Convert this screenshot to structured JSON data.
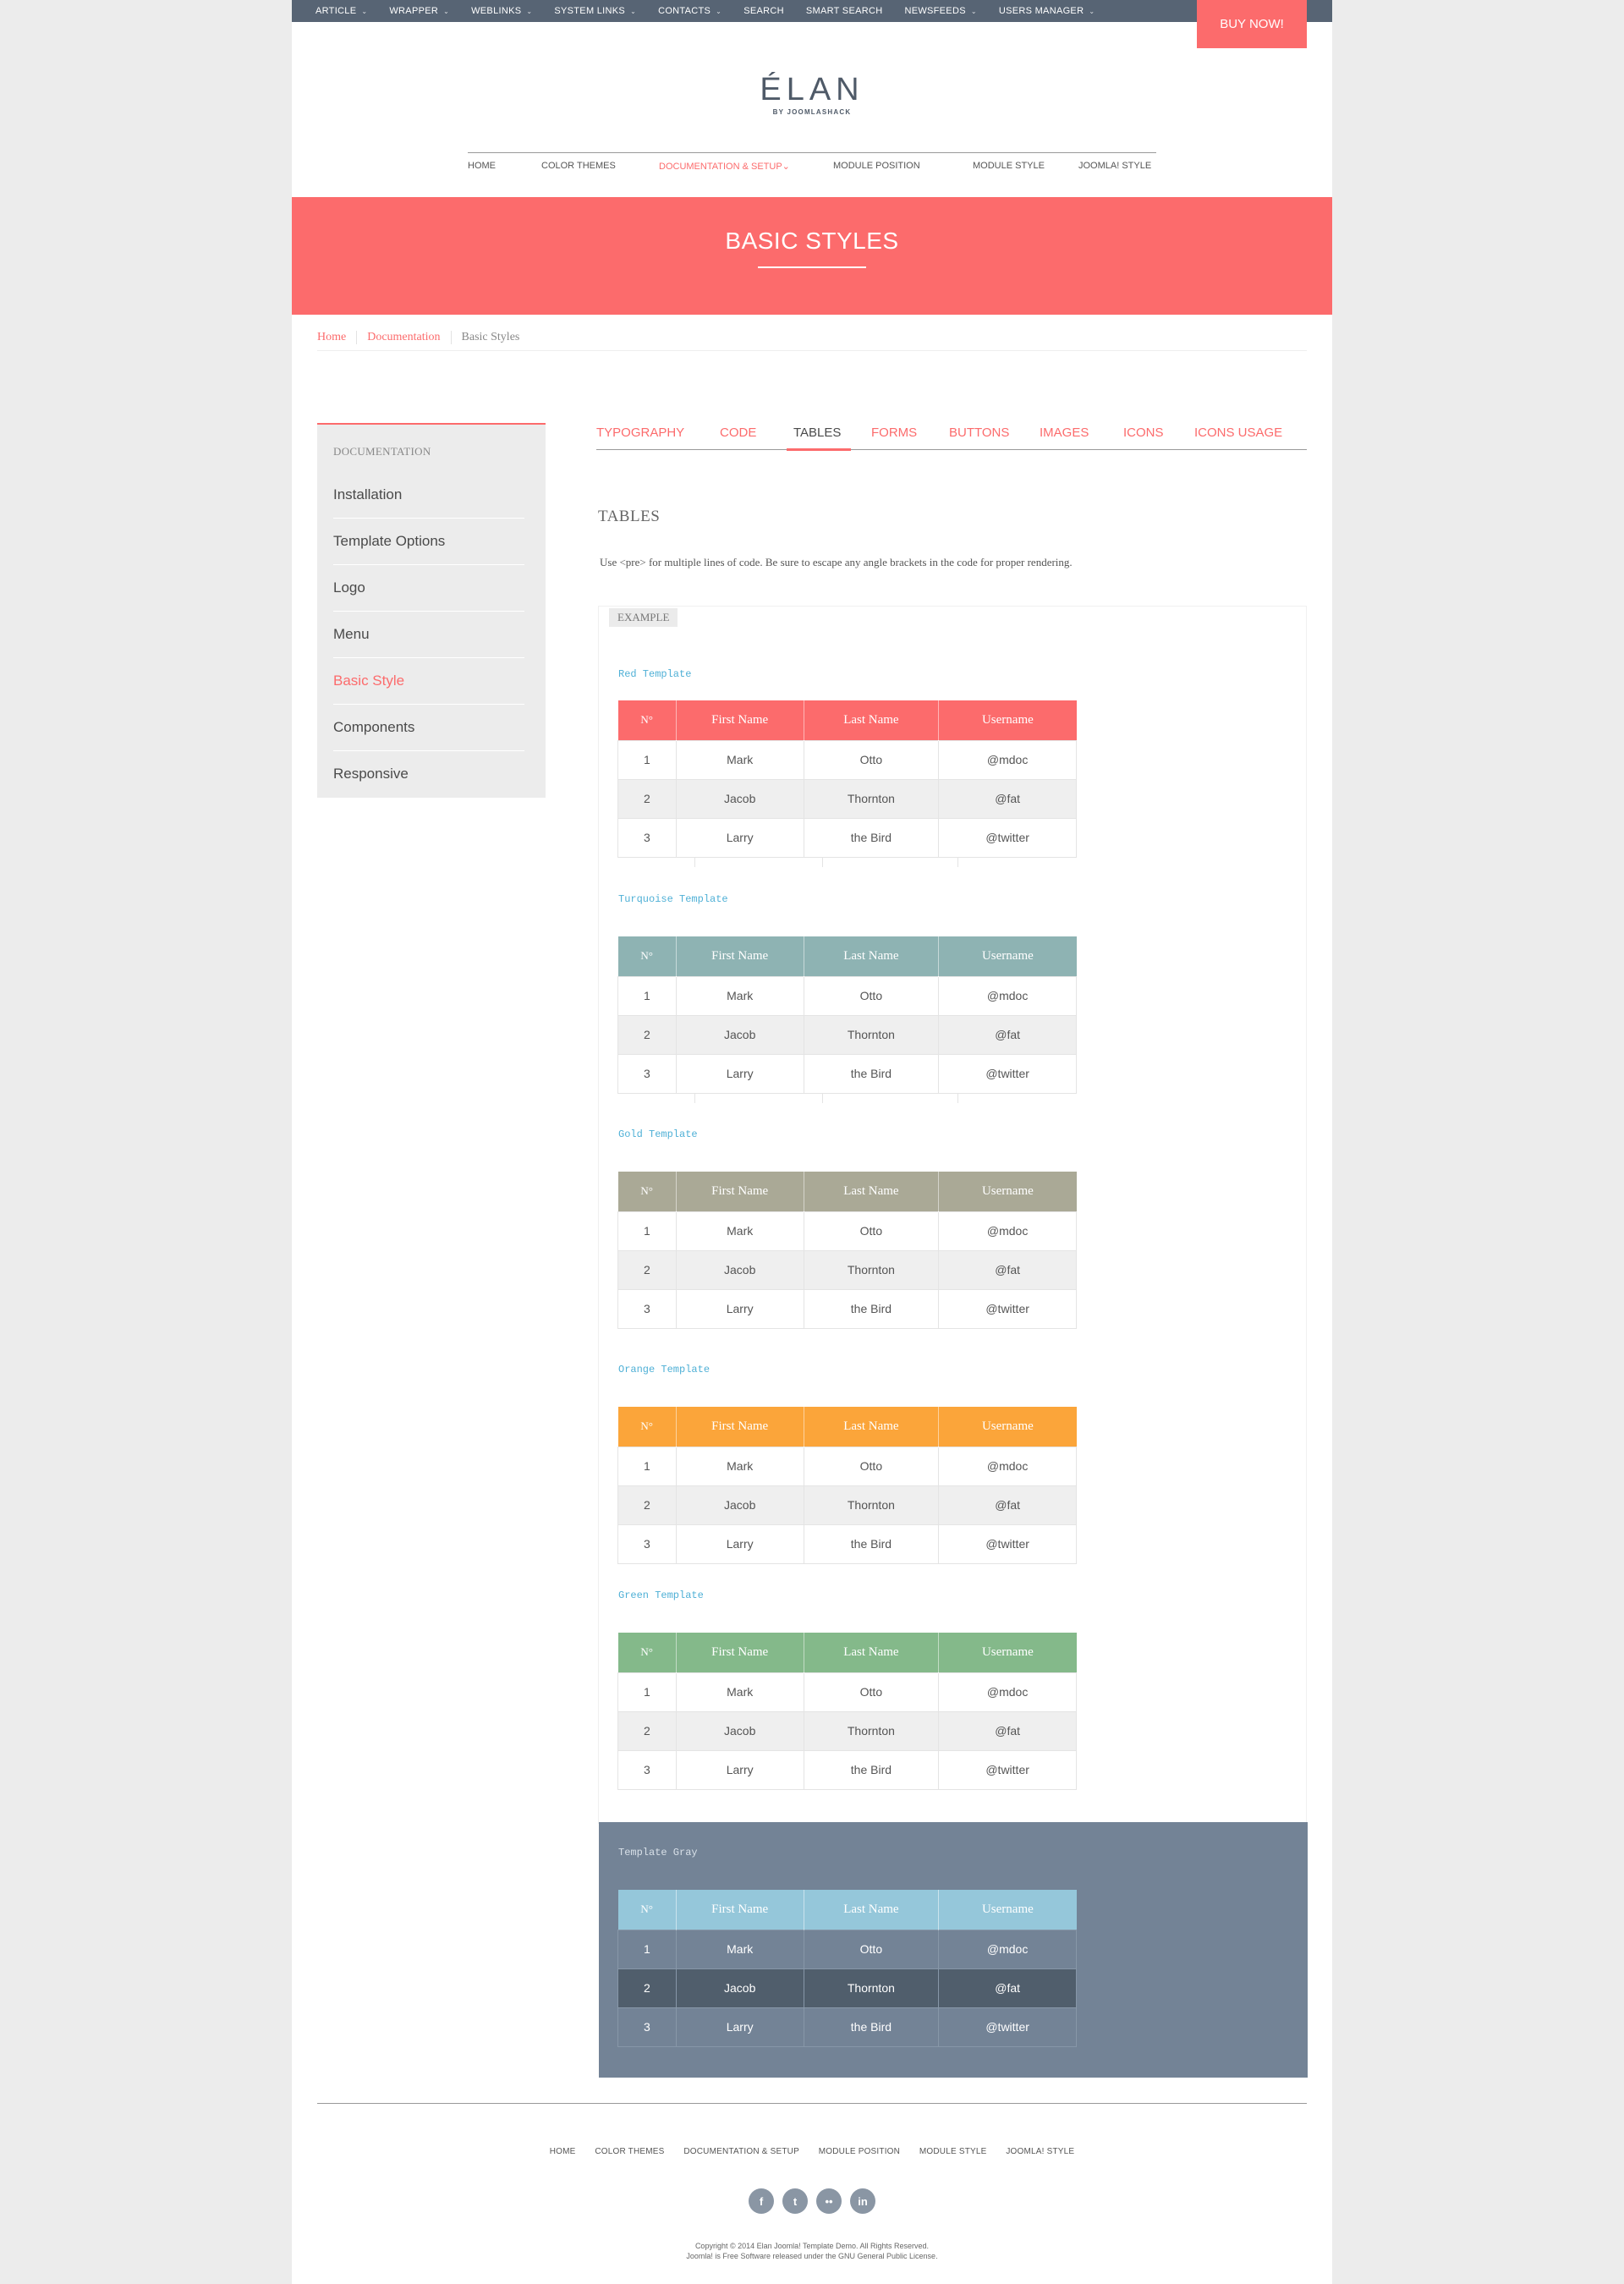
{
  "top_nav": {
    "items": [
      {
        "label": "ARTICLE",
        "caret": "⌄"
      },
      {
        "label": "WRAPPER",
        "caret": "⌄"
      },
      {
        "label": "WEBLINKS",
        "caret": "⌄"
      },
      {
        "label": "SYSTEM LINKS",
        "caret": "⌄"
      },
      {
        "label": "CONTACTS",
        "caret": "⌄"
      },
      {
        "label": "SEARCH",
        "caret": ""
      },
      {
        "label": "SMART SEARCH",
        "caret": ""
      },
      {
        "label": "NEWSFEEDS",
        "caret": "⌄"
      },
      {
        "label": "USERS MANAGER",
        "caret": "⌄"
      }
    ],
    "buy_label": "BUY NOW!"
  },
  "logo": {
    "title": "ÉLAN",
    "subtitle": "BY JOOMLASHACK"
  },
  "main_nav": {
    "items": [
      {
        "label": "HOME"
      },
      {
        "label": "COLOR THEMES"
      },
      {
        "label": "DOCUMENTATION & SETUP",
        "caret": "⌄"
      },
      {
        "label": "MODULE POSITION"
      },
      {
        "label": "MODULE STYLE"
      },
      {
        "label": "JOOMLA! STYLE"
      }
    ]
  },
  "hero": {
    "title": "BASIC STYLES"
  },
  "breadcrumb": [
    "Home",
    "Documentation",
    "Basic Styles"
  ],
  "sidebar": {
    "heading": "DOCUMENTATION",
    "items": [
      "Installation",
      "Template Options",
      "Logo",
      "Menu",
      "Basic Style",
      "Components",
      "Responsive"
    ]
  },
  "tabs": [
    "TYPOGRAPHY",
    "CODE",
    "TABLES",
    "FORMS",
    "BUTTONS",
    "IMAGES",
    "ICONS",
    "ICONS USAGE"
  ],
  "section": {
    "title": "TABLES",
    "description": "Use <pre> for multiple lines of code. Be sure to escape any angle brackets in the code for proper rendering."
  },
  "example_label": "EXAMPLE",
  "table_headers": [
    "N°",
    "First Name",
    "Last Name",
    "Username"
  ],
  "table_rows": [
    [
      "1",
      "Mark",
      "Otto",
      "@mdoc"
    ],
    [
      "2",
      "Jacob",
      "Thornton",
      "@fat"
    ],
    [
      "3",
      "Larry",
      "the Bird",
      "@twitter"
    ]
  ],
  "templates": [
    {
      "name": "Red Template",
      "color": "#fc6b6c"
    },
    {
      "name": "Turquoise Template",
      "color": "#8eb3b3"
    },
    {
      "name": "Gold Template",
      "color": "#aaa996"
    },
    {
      "name": "Orange Template",
      "color": "#fba53a"
    },
    {
      "name": "Green Template",
      "color": "#84b98a"
    },
    {
      "name": "Template Gray",
      "color": "#95c7da"
    }
  ],
  "footer": {
    "nav": [
      "HOME",
      "COLOR THEMES",
      "DOCUMENTATION & SETUP",
      "MODULE POSITION",
      "MODULE STYLE",
      "JOOMLA! STYLE"
    ],
    "social": [
      {
        "icon": "facebook-icon",
        "glyph": "f"
      },
      {
        "icon": "twitter-icon",
        "glyph": "t"
      },
      {
        "icon": "flickr-icon",
        "glyph": "••"
      },
      {
        "icon": "linkedin-icon",
        "glyph": "in"
      }
    ],
    "copyright_1": "Copyright © 2014 Elan Joomla! Template Demo. All Rights Reserved.",
    "copyright_2": "Joomla! is Free Software released under the GNU General Public License."
  }
}
